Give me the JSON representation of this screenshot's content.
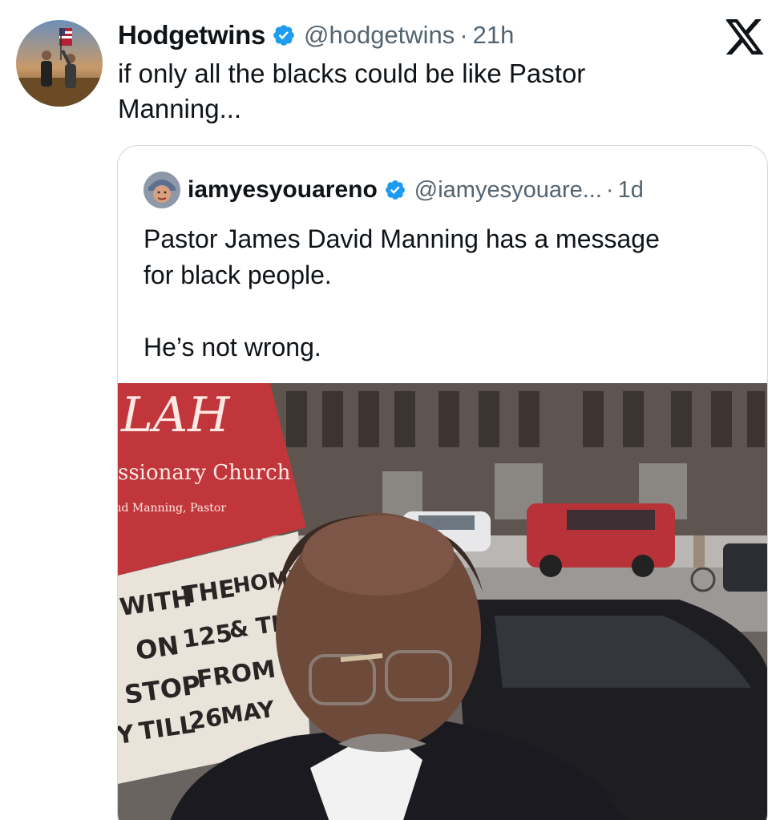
{
  "tweet": {
    "author": {
      "name": "Hodgetwins",
      "handle": "@hodgetwins",
      "time": "21h",
      "avatar_icon": "avatar-photo"
    },
    "text_lines": [
      "if only all the blacks could be like Pastor",
      "Manning..."
    ],
    "platform_icon": "x-logo-icon"
  },
  "quoted": {
    "author": {
      "name": "iamyesyouareno",
      "handle": "@iamyesyouare...",
      "time": "1d"
    },
    "text_lines": [
      "Pastor James David Manning has a message",
      "for black people."
    ],
    "text_line_2": "He’s not wrong.",
    "media": {
      "sign_title": "LAH",
      "sign_subtitle": "ssionary Church",
      "sign_small": "ıd Manning, Pastor",
      "board_rows": [
        [
          "WITH",
          "THE",
          "HOMELE"
        ],
        [
          "ON",
          "125",
          "& TH"
        ],
        [
          "STOP",
          "FROM",
          ""
        ],
        [
          "Y",
          "TILL",
          "26",
          "MAY"
        ]
      ]
    }
  },
  "colors": {
    "text": "#0f1419",
    "secondary": "#536471",
    "verified": "#1d9bf0",
    "border": "#cfd9de"
  },
  "separator": "·"
}
